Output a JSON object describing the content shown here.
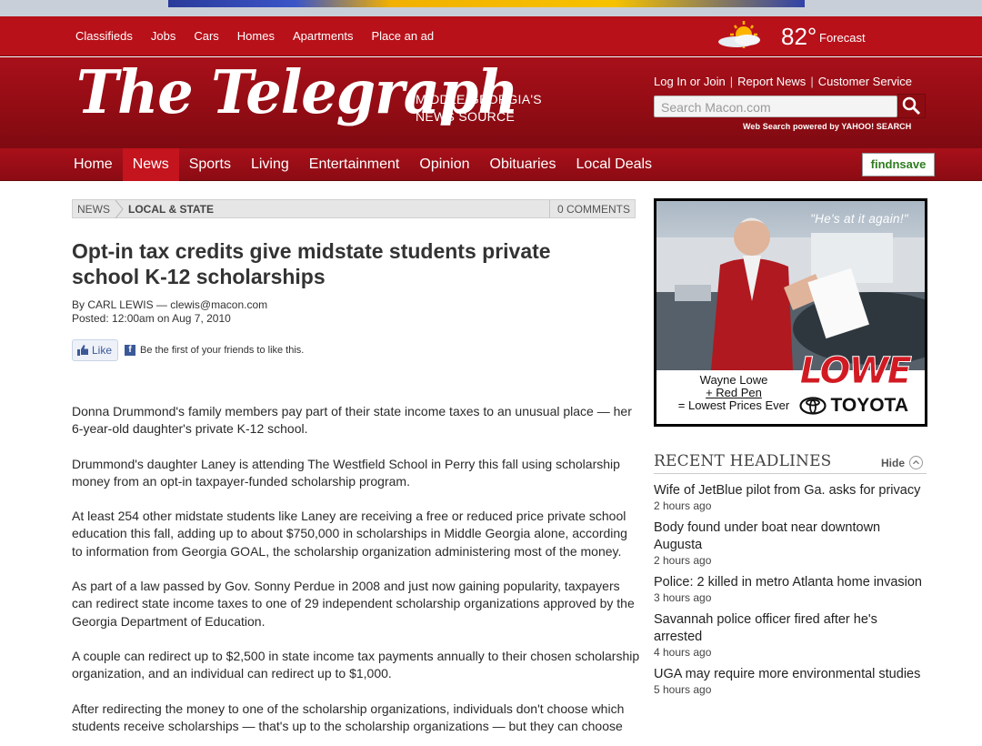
{
  "utility_nav": {
    "links": [
      "Classifieds",
      "Jobs",
      "Cars",
      "Homes",
      "Apartments",
      "Place an ad"
    ]
  },
  "weather": {
    "temp": "82°",
    "forecast_label": "Forecast",
    "icon": "sun-cloud-icon"
  },
  "masthead": {
    "logo": "The Telegraph",
    "tagline_line1": "MIDDLE GEORGIA'S",
    "tagline_line2": "NEWS SOURCE",
    "account_links": [
      "Log In or Join",
      "Report News",
      "Customer Service"
    ],
    "search_placeholder": "Search Macon.com",
    "search_note": "Web Search powered by YAHOO! SEARCH"
  },
  "main_nav": {
    "items": [
      "Home",
      "News",
      "Sports",
      "Living",
      "Entertainment",
      "Opinion",
      "Obituaries",
      "Local Deals"
    ],
    "active": "News",
    "findsave": "findnsave"
  },
  "breadcrumb": {
    "section": "NEWS",
    "subsection": "LOCAL & STATE",
    "comments": "0 COMMENTS"
  },
  "article": {
    "headline": "Opt-in tax credits give midstate students private school K-12 scholarships",
    "byline": "By CARL LEWIS — clewis@macon.com",
    "posted": "Posted: 12:00am on Aug 7, 2010",
    "like_label": "Like",
    "like_text": "Be the first of your friends to like this.",
    "paragraphs": [
      "Donna Drummond's family members pay part of their state income taxes to an unusual place — her 6-year-old daughter's private K-12 school.",
      "Drummond's daughter Laney is attending The Westfield School in Perry this fall using scholarship money from an opt-in taxpayer-funded scholarship program.",
      "At least 254 other midstate students like Laney are receiving a free or reduced price private school education this fall, adding up to about $750,000 in scholarships in Middle Georgia alone, according to information from Georgia GOAL, the scholarship organization administering most of the money.",
      "As part of a law passed by Gov. Sonny Perdue in 2008 and just now gaining popularity, taxpayers can redirect state income taxes to one of 29 independent scholarship organizations approved by the Georgia Department of Education.",
      "A couple can redirect up to $2,500 in state income tax payments annually to their chosen scholarship organization, and an individual can redirect up to $1,000.",
      "After redirecting the money to one of the scholarship organizations, individuals don't choose which students receive scholarships — that's up to the scholarship organizations — but they can choose"
    ]
  },
  "ad": {
    "quote": "\"He's at it again!\"",
    "eq_line1": "Wayne Lowe",
    "eq_line2": "+ Red Pen",
    "eq_line3": "= Lowest Prices Ever",
    "brand1": "LOWE",
    "brand2": "TOYOTA"
  },
  "recent_headlines": {
    "title": "RECENT HEADLINES",
    "hide_label": "Hide",
    "items": [
      {
        "title": "Wife of JetBlue pilot from Ga. asks for privacy",
        "time": "2 hours ago"
      },
      {
        "title": "Body found under boat near downtown Augusta",
        "time": "2 hours ago"
      },
      {
        "title": "Police: 2 killed in metro Atlanta home invasion",
        "time": "3 hours ago"
      },
      {
        "title": "Savannah police officer fired after he's arrested",
        "time": "4 hours ago"
      },
      {
        "title": "UGA may require more environmental studies",
        "time": "5 hours ago"
      }
    ]
  }
}
